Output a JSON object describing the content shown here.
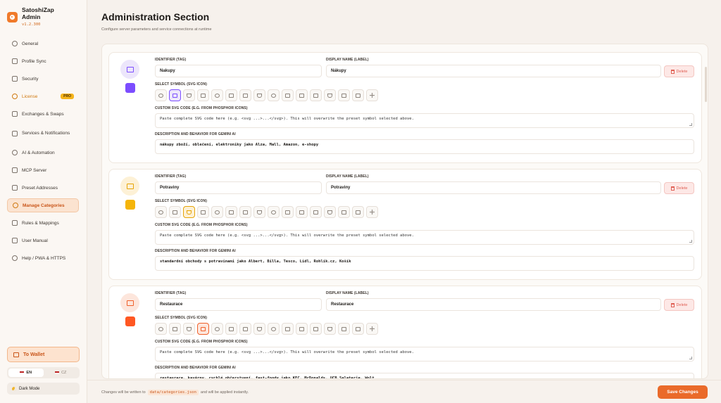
{
  "brand": {
    "name": "SatoshiZap",
    "sub": "Admin",
    "version": "v1.2.300"
  },
  "nav": [
    {
      "label": "General",
      "icon": "gear-icon"
    },
    {
      "label": "Profile Sync",
      "icon": "sync-icon"
    },
    {
      "label": "Security",
      "icon": "shield-icon"
    },
    {
      "label": "License",
      "icon": "key-icon",
      "badge": "PRO"
    },
    {
      "label": "Exchanges & Swaps",
      "icon": "chart-icon"
    },
    {
      "label": "Services & Notifications",
      "icon": "bell-icon"
    },
    {
      "label": "AI & Automation",
      "icon": "sparkle-icon"
    },
    {
      "label": "MCP Server",
      "icon": "plug-icon"
    },
    {
      "label": "Preset Addresses",
      "icon": "book-icon"
    },
    {
      "label": "Manage Categories",
      "icon": "tag-icon",
      "active": true
    },
    {
      "label": "Rules & Mappings",
      "icon": "rules-icon"
    },
    {
      "label": "User Manual",
      "icon": "manual-icon"
    },
    {
      "label": "Help / PWA & HTTPS",
      "icon": "globe-icon"
    }
  ],
  "sidebar_bottom": {
    "wallet": "To Wallet",
    "lang_en": "EN",
    "lang_cz": "CZ",
    "dark_mode": "Dark Mode"
  },
  "header": {
    "title": "Administration Section",
    "subtitle": "Configure server parameters and service connections at runtime"
  },
  "labels": {
    "identifier": "IDENTIFIER (TAG)",
    "display_name": "DISPLAY NAME (LABEL)",
    "select_symbol": "SELECT SYMBOL (SVG ICON)",
    "custom_svg": "CUSTOM SVG CODE (E.G. FROM PHOSPHOR ICONS)",
    "description": "DESCRIPTION AND BEHAVIOR FOR GEMINI AI",
    "delete": "Delete",
    "svg_placeholder": "Paste complete SVG code here (e.g. <svg ...>...</svg>). This will overwrite the preset symbol selected above."
  },
  "categories": [
    {
      "identifier": "Nakupy",
      "display_name": "Nákupy",
      "description": "nákupy zboží, oblečení, elektroniky jako Alza, Mall, Amazon, e-shopy",
      "color": "#7c4dff",
      "avatar_bg": "#ece6fb",
      "avatar_fg": "#7c4dff",
      "selected_icon": 1,
      "icon": "shopping-bag-icon"
    },
    {
      "identifier": "Potraviny",
      "display_name": "Potraviny",
      "description": "standardní obchody s potravinami jako Albert, Billa, Tesco, Lidl, Rohlík.cz, Košík",
      "color": "#f5b50a",
      "avatar_bg": "#fdf1d6",
      "avatar_fg": "#e6a406",
      "selected_icon": 2,
      "icon": "basket-icon"
    },
    {
      "identifier": "Restaurace",
      "display_name": "Restaurace",
      "description": "restaurace, kavárny, rychlé občerstvení, fast-foody jako KFC, McDonalds, UCB Salaterie, Wolt",
      "color": "#ff5722",
      "avatar_bg": "#fde6dc",
      "avatar_fg": "#f0602a",
      "selected_icon": 3,
      "icon": "fork-knife-icon"
    }
  ],
  "symbols": [
    "coins-icon",
    "shopping-bag-icon",
    "basket-icon",
    "fork-knife-icon",
    "coffee-icon",
    "gas-pump-icon",
    "car-icon",
    "plane-icon",
    "game-controller-icon",
    "heart-icon",
    "briefcase-icon",
    "house-icon",
    "arrows-icon",
    "gift-icon",
    "chart-icon",
    "plus-icon"
  ],
  "footer": {
    "text_before": "Changes will be written to",
    "path": "data/categories.json",
    "text_after": "and will be applied instantly.",
    "save": "Save Changes"
  }
}
